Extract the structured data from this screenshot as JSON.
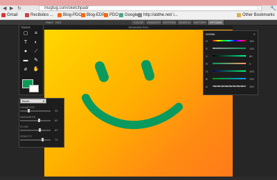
{
  "browser": {
    "url": "mugtug.com/sketchpad/",
    "bookmarks": [
      {
        "label": "Gmail",
        "color": "#d33"
      },
      {
        "label": "Recibidos ...",
        "color": "#c44"
      },
      {
        "label": "Blog-PDO",
        "color": "#f60"
      },
      {
        "label": "Blog-EDP",
        "color": "#f60"
      },
      {
        "label": "PDO",
        "color": "#f60"
      },
      {
        "label": "Google",
        "color": "#4a8"
      },
      {
        "label": "http://atdhe.net/ i...",
        "color": "#888"
      }
    ],
    "other_bookmarks": "Other Bookmarks"
  },
  "app": {
    "menu": [
      "PAINT",
      "EDIT"
    ],
    "tabs": [
      {
        "label": "COLOR",
        "active": false
      },
      {
        "label": "GRADIENT",
        "active": false
      },
      {
        "label": "PATTERN",
        "active": false
      },
      {
        "label": "SEARCH",
        "active": false
      },
      {
        "label": "HISTORY",
        "active": false
      },
      {
        "label": "OPTIONS",
        "active": true
      }
    ],
    "canvas_title": "DRAWING.PNG"
  },
  "tools": {
    "title": "TOOLS",
    "items": [
      "select-icon",
      "crop-icon",
      "text-icon",
      "shape-icon",
      "brush-icon",
      "pencil-icon",
      "eraser-icon",
      "smudge-icon",
      "eyedropper-icon",
      "hand-icon"
    ],
    "primary_color": "#0a9a55",
    "secondary_color": "#ffffff"
  },
  "brush": {
    "selected": "Brush",
    "sliders": [
      {
        "label": "DIAMETER",
        "value": "25",
        "fraction": 0.25
      },
      {
        "label": "HARDNESS",
        "value": "60",
        "fraction": 0.6
      },
      {
        "label": "FLOW",
        "value": "62",
        "fraction": 0.62
      },
      {
        "label": "OPACITY",
        "value": "70",
        "fraction": 0.7
      }
    ]
  },
  "color_panel": {
    "hex": "009966",
    "rows": [
      {
        "label": "H",
        "value": "160"
      },
      {
        "label": "S",
        "value": "100"
      },
      {
        "label": "V",
        "value": "60"
      },
      {
        "label": "R",
        "value": "0"
      },
      {
        "label": "G",
        "value": "153"
      },
      {
        "label": "B",
        "value": "102"
      },
      {
        "label": "A",
        "value": "100"
      }
    ]
  },
  "colors": {
    "stroke": "#0a9a5e"
  }
}
